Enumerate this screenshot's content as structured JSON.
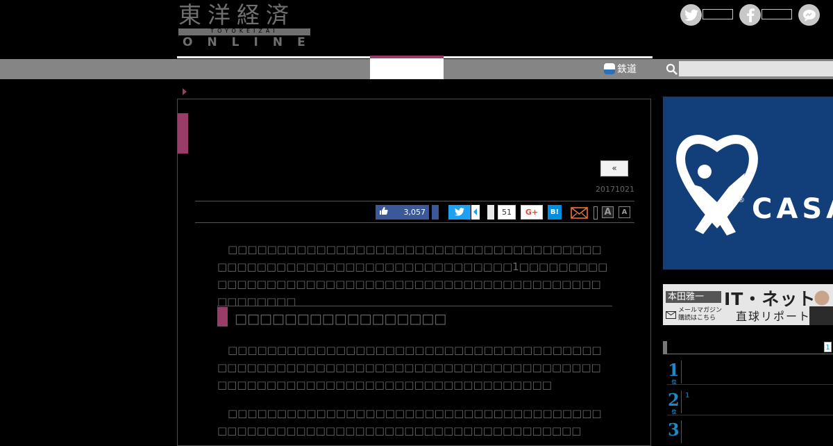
{
  "header": {
    "logo_kanji": "東洋経済",
    "logo_band": "TOYOKEIZAI",
    "logo_online": "ONLINE",
    "social": [
      {
        "icon": "twitter-icon",
        "glyph": "🐦"
      },
      {
        "icon": "facebook-icon",
        "glyph": "f"
      },
      {
        "icon": "messenger-icon",
        "glyph": "~"
      }
    ]
  },
  "nav": {
    "tetsudo_label": "鉄道",
    "search_placeholder": ""
  },
  "article": {
    "back_label": "«",
    "date": "20171021",
    "share": {
      "fb_count": "3,057",
      "pocket_count": "51",
      "gplus_label": "G+",
      "hatena_label": "B!",
      "font_big": "A",
      "font_small": "A"
    },
    "p1": "　□□□□□□□□□□□□□□□□□□□□□□□□□□□□□□□□□□□□□□□□□□□□□□□□□□□□□□□□□□□□□□□□□□□□1□□□□□□□□□□□□□□□□□□□□□□□□□□□□□□□□□□□□□□□□□□□□□□□□□□□□□□□□",
    "h2": "□□□□□□□□□□□□□□□□□",
    "p2": "　□□□□□□□□□□□□□□□□□□□□□□□□□□□□□□□□□□□□□□□□□□□□□□□□□□□□□□□□□□□□□□□□□□□□□□□□□□□□□□□□□□□□□□□□□□□□□□□□□□□□□□□□□□□□□□□",
    "p3": "　□□□□□□□□□□□□□□□□□□□□□□□□□□□□□□□□□□□□□□□□□□□□□□□□□□□□□□□□□□□□□□□□□□□□□□□□□□□"
  },
  "sidebar": {
    "ad_text": "CASA",
    "ad_registered": "®",
    "promo": {
      "name": "本田雅一",
      "title": "IT・ネット",
      "subtitle": "直球リポート",
      "mail_line1": "メールマガジン",
      "mail_line2": "購読はこちら"
    },
    "ranking": {
      "page_badge": "1",
      "suffix": "位",
      "items": [
        {
          "rank": "1",
          "text": ""
        },
        {
          "rank": "2",
          "text": "1"
        },
        {
          "rank": "3",
          "text": ""
        }
      ]
    }
  },
  "colors": {
    "accent": "#9a3c68",
    "nav_gray": "#858585",
    "rank_blue": "#1e88c7",
    "ad_navy": "#123e7a"
  }
}
